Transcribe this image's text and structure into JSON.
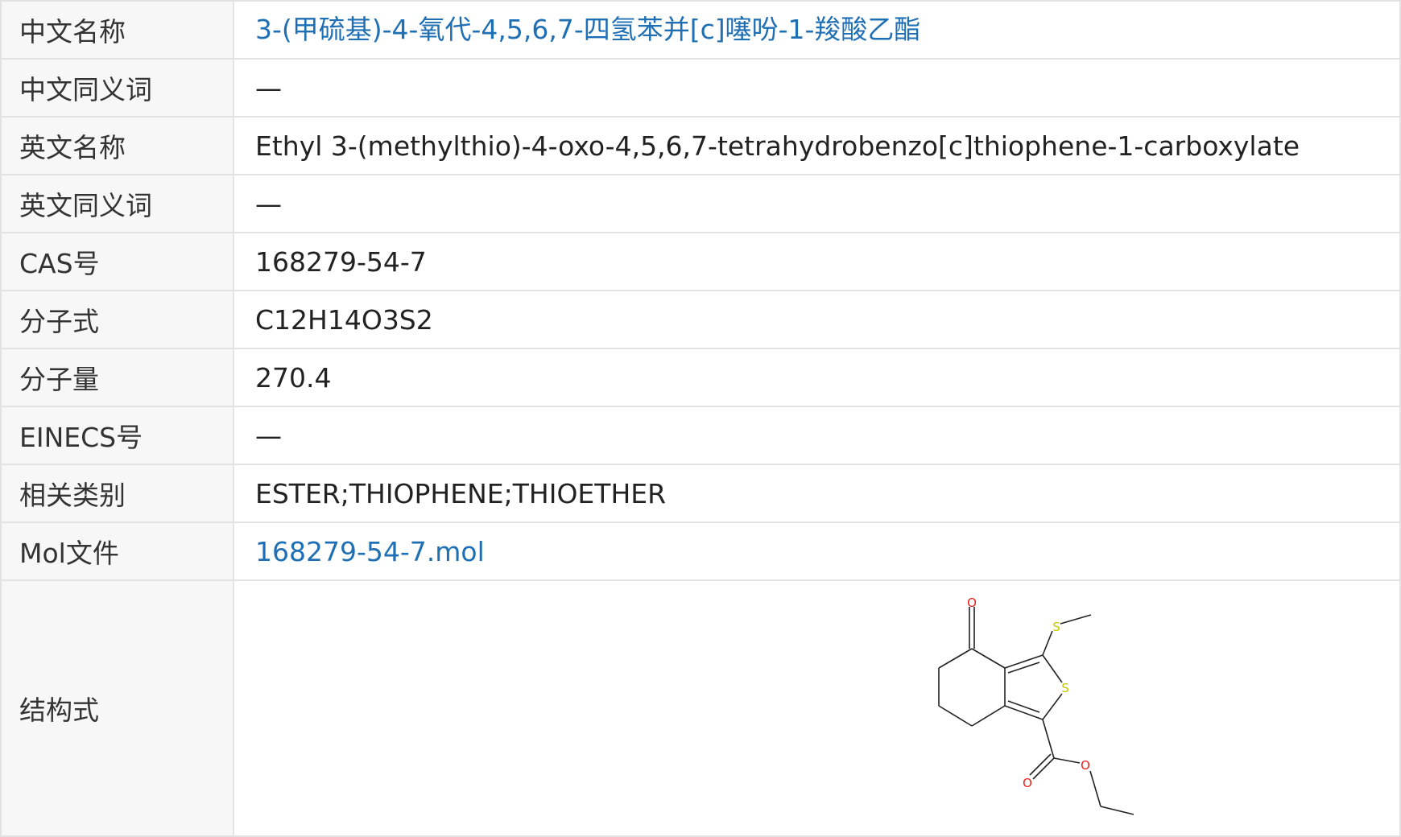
{
  "rows": [
    {
      "label": "中文名称",
      "value": "3-(甲硫基)-4-氧代-4,5,6,7-四氢苯并[c]噻吩-1-羧酸乙酯",
      "link": true
    },
    {
      "label": "中文同义词",
      "value": "—",
      "link": false
    },
    {
      "label": "英文名称",
      "value": "Ethyl 3-(methylthio)-4-oxo-4,5,6,7-tetrahydrobenzo[c]thiophene-1-carboxylate",
      "link": false
    },
    {
      "label": "英文同义词",
      "value": "—",
      "link": false
    },
    {
      "label": "CAS号",
      "value": "168279-54-7",
      "link": false
    },
    {
      "label": "分子式",
      "value": "C12H14O3S2",
      "link": false
    },
    {
      "label": "分子量",
      "value": "270.4",
      "link": false
    },
    {
      "label": "EINECS号",
      "value": "—",
      "link": false
    },
    {
      "label": "相关类别",
      "value": "ESTER;THIOPHENE;THIOETHER",
      "link": false
    },
    {
      "label": "Mol文件",
      "value": "168279-54-7.mol",
      "link": true
    }
  ],
  "structure": {
    "label": "结构式",
    "atoms": {
      "oxygen": "O",
      "sulfur": "S"
    },
    "colors": {
      "oxygen": "#e8211c",
      "sulfur": "#c8c800",
      "bond": "#222222"
    }
  }
}
